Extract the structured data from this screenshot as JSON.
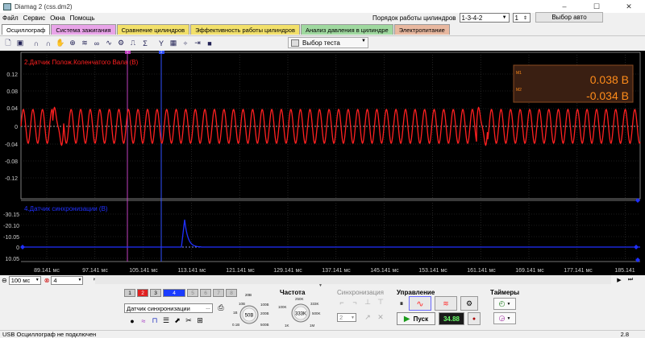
{
  "window": {
    "title": "Diamag 2 (css.dm2)",
    "minimize": "–",
    "maximize": "☐",
    "close": "✕"
  },
  "menu": [
    "Файл",
    "Сервис",
    "Окна",
    "Помощь"
  ],
  "cylinder_order": {
    "label": "Порядок работы цилиндров",
    "value": "1-3-4-2",
    "spin_value": "1"
  },
  "auto_button": "Выбор авто",
  "tabs": [
    {
      "label": "Осциллограф",
      "color": "#ffffff"
    },
    {
      "label": "Система зажигания",
      "color": "#e8a4e8"
    },
    {
      "label": "Сравнение цилиндров",
      "color": "#f2e06a"
    },
    {
      "label": "Эффективность работы цилиндров",
      "color": "#f2e06a"
    },
    {
      "label": "Анализ давления в цилиндре",
      "color": "#9fd89f"
    },
    {
      "label": "Электропитание",
      "color": "#e8b8a0"
    }
  ],
  "toolbar": {
    "test_select": "Выбор теста"
  },
  "scope": {
    "top_channel_label": "2.Датчик Полож.Коленчатого Вала (В)",
    "bottom_channel_label": "4.Датчик синхронизации (В)",
    "top_y_ticks": [
      "0.12",
      "0.08",
      "0.04",
      "0",
      "-0.04",
      "-0.08",
      "-0.12"
    ],
    "bottom_y_ticks": [
      "-30.15",
      "-20.10",
      "-10.05",
      "0",
      "10.05"
    ],
    "x_ticks": [
      "89.141 мс",
      "97.141 мс",
      "105.141 мс",
      "113.141 мс",
      "121.141 мс",
      "129.141 мс",
      "137.141 мс",
      "145.141 мс",
      "153.141 мс",
      "161.141 мс",
      "169.141 мс",
      "177.141 мс",
      "185.141"
    ],
    "marker1_label": "1",
    "marker2_label": "2",
    "cursor_box": {
      "m1_label": "M1",
      "m2_label": "M2",
      "value1": "0.038 В",
      "value2": "-0.034 В"
    },
    "colors": {
      "channel2": "#ff2020",
      "channel4": "#2030ff",
      "marker1": "#c040c0",
      "marker2": "#3050ff",
      "readout": "#ff8c1a"
    }
  },
  "nav": {
    "time_div": "100 мс",
    "channel": "4"
  },
  "panel": {
    "channels": [
      "1",
      "2",
      "3",
      "4",
      "5",
      "6",
      "7",
      "8"
    ],
    "channel_select": "Датчик синхронизации",
    "voltage_knob": {
      "labels": [
        "10В",
        "20В",
        "100В",
        "200В",
        "500В",
        "1В",
        "0.1В"
      ],
      "center": "50В"
    },
    "frequency": {
      "title": "Частота",
      "labels": [
        "250K",
        "333K",
        "500K",
        "1M",
        "1K",
        "100K"
      ],
      "center": "333K"
    },
    "sync": {
      "title": "Синхронизация",
      "value": "2"
    },
    "control": {
      "title": "Управление",
      "start": "Пуск",
      "fps": "34.88"
    },
    "timers": {
      "title": "Таймеры"
    }
  },
  "status": {
    "text": "USB Осциллограф не подключен",
    "version": "2.8"
  }
}
